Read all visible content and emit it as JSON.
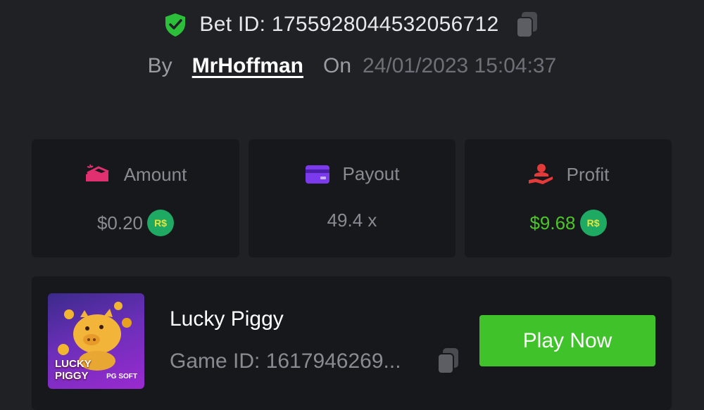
{
  "bet": {
    "id_text": "Bet ID: 1755928044532056712",
    "verified_icon": "shield-check-icon",
    "copy_icon": "copy-icon"
  },
  "meta": {
    "by_label": "By",
    "username": "MrHoffman",
    "on_label": "On",
    "datetime": "24/01/2023 15:04:37"
  },
  "stats": [
    {
      "label": "Amount",
      "value": "$0.20",
      "icon": "money-stack-icon",
      "currency_badge": "R$"
    },
    {
      "label": "Payout",
      "value": "49.4 x",
      "icon": "wallet-card-icon"
    },
    {
      "label": "Profit",
      "value": "$9.68",
      "icon": "hand-profit-icon",
      "currency_badge": "R$"
    }
  ],
  "game": {
    "title": "Lucky Piggy",
    "id_text": "Game ID: 1617946269...",
    "thumbnail_text_line1": "LUCKY",
    "thumbnail_text_line2": "PIGGY",
    "thumbnail_brand": "PG SOFT",
    "play_label": "Play Now"
  },
  "colors": {
    "background": "#202125",
    "card": "#17181c",
    "accent_green": "#3fc22a",
    "profit_green": "#4cc528",
    "coin_green": "#1faa64",
    "amount_icon": "#e0306f",
    "payout_icon": "#7c3aed",
    "profit_icon": "#e43a3a"
  }
}
